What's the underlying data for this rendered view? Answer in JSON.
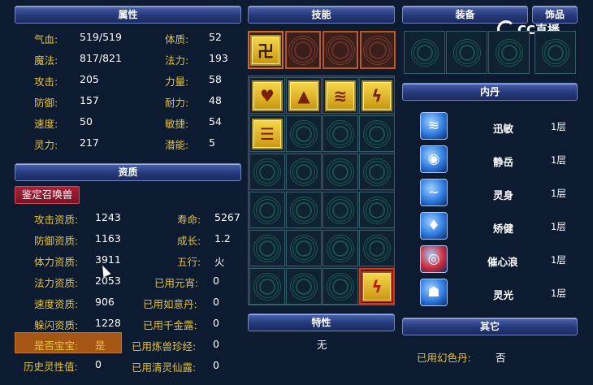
{
  "panels": {
    "attributes": "属性",
    "skills": "技能",
    "equipment": "装备",
    "accessory": "饰品",
    "aptitude": "资质",
    "inner_dan": "内丹",
    "traits": "特性",
    "other": "其它"
  },
  "attributes": {
    "left": [
      {
        "label": "气血:",
        "value": "519/519"
      },
      {
        "label": "魔法:",
        "value": "817/821"
      },
      {
        "label": "攻击:",
        "value": "205"
      },
      {
        "label": "防御:",
        "value": "157"
      },
      {
        "label": "速度:",
        "value": "50"
      },
      {
        "label": "灵力:",
        "value": "217"
      }
    ],
    "right": [
      {
        "label": "体质:",
        "value": "52"
      },
      {
        "label": "法力:",
        "value": "193"
      },
      {
        "label": "力量:",
        "value": "58"
      },
      {
        "label": "耐力:",
        "value": "48"
      },
      {
        "label": "敏捷:",
        "value": "54"
      },
      {
        "label": "潜能:",
        "value": "5"
      }
    ]
  },
  "appraise_button": "鉴定召唤兽",
  "aptitude": {
    "left": [
      {
        "label": "攻击资质:",
        "value": "1243"
      },
      {
        "label": "防御资质:",
        "value": "1163"
      },
      {
        "label": "体力资质:",
        "value": "3911"
      },
      {
        "label": "法力资质:",
        "value": "2053"
      },
      {
        "label": "速度资质:",
        "value": "906"
      },
      {
        "label": "躲闪资质:",
        "value": "1228"
      }
    ],
    "right": [
      {
        "label": "寿命:",
        "value": "5267"
      },
      {
        "label": "成长:",
        "value": "1.2"
      },
      {
        "label": "五行:",
        "value": "火"
      },
      {
        "label": "已用元宵:",
        "value": "0"
      },
      {
        "label": "已用如意丹:",
        "value": "0"
      },
      {
        "label": "已用千金露:",
        "value": "0"
      },
      {
        "label": "已用炼兽珍经:",
        "value": "0"
      },
      {
        "label": "已用清灵仙露:",
        "value": "0"
      }
    ],
    "is_baby_label": "是否宝宝:",
    "is_baby_value": "是",
    "history_label": "历史灵性值:",
    "history_value": "0"
  },
  "skills_top": [
    {
      "icon": "卍-rune-icon",
      "glyph": "卍",
      "active": true
    },
    {
      "icon": "empty-slot-icon",
      "glyph": "",
      "active": false
    },
    {
      "icon": "empty-slot-icon",
      "glyph": "",
      "active": false
    },
    {
      "icon": "empty-slot-icon",
      "glyph": "",
      "active": false
    }
  ],
  "skill_grid": [
    [
      "heart",
      "arrow",
      "wave",
      "lightning"
    ],
    [
      "scroll",
      "",
      "",
      ""
    ],
    [
      "",
      "",
      "",
      ""
    ],
    [
      "",
      "",
      "",
      ""
    ],
    [
      "",
      "",
      "",
      ""
    ],
    [
      "",
      "",
      "",
      "lightning-bolt"
    ]
  ],
  "inner_dan": [
    {
      "name": "迅敏",
      "level": "1层",
      "color": "#2f7be0",
      "glyph": "≋"
    },
    {
      "name": "静岳",
      "level": "1层",
      "color": "#2f7be0",
      "glyph": "◉"
    },
    {
      "name": "灵身",
      "level": "1层",
      "color": "#2f7be0",
      "glyph": "~"
    },
    {
      "name": "矫健",
      "level": "1层",
      "color": "#2f7be0",
      "glyph": "♦"
    },
    {
      "name": "催心浪",
      "level": "1层",
      "color": "#d02b3a",
      "glyph": "◎"
    },
    {
      "name": "灵光",
      "level": "1层",
      "color": "#2f7be0",
      "glyph": "☗"
    }
  ],
  "traits_value": "无",
  "other": {
    "label": "已用幻色丹:",
    "value": "否"
  },
  "logo_text": "CC直播",
  "colors": {
    "label": "#e8c13a",
    "header": "#26397a",
    "button": "#a82138",
    "baby_bg": "#a55614"
  }
}
